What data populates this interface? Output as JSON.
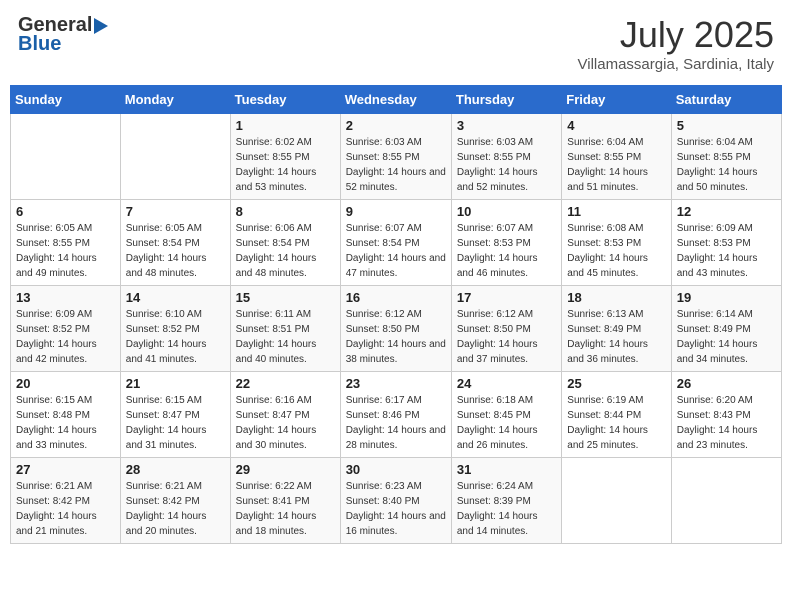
{
  "header": {
    "logo_general": "General",
    "logo_blue": "Blue",
    "month_year": "July 2025",
    "location": "Villamassargia, Sardinia, Italy"
  },
  "weekdays": [
    "Sunday",
    "Monday",
    "Tuesday",
    "Wednesday",
    "Thursday",
    "Friday",
    "Saturday"
  ],
  "weeks": [
    [
      {
        "day": "",
        "sunrise": "",
        "sunset": "",
        "daylight": ""
      },
      {
        "day": "",
        "sunrise": "",
        "sunset": "",
        "daylight": ""
      },
      {
        "day": "1",
        "sunrise": "Sunrise: 6:02 AM",
        "sunset": "Sunset: 8:55 PM",
        "daylight": "Daylight: 14 hours and 53 minutes."
      },
      {
        "day": "2",
        "sunrise": "Sunrise: 6:03 AM",
        "sunset": "Sunset: 8:55 PM",
        "daylight": "Daylight: 14 hours and 52 minutes."
      },
      {
        "day": "3",
        "sunrise": "Sunrise: 6:03 AM",
        "sunset": "Sunset: 8:55 PM",
        "daylight": "Daylight: 14 hours and 52 minutes."
      },
      {
        "day": "4",
        "sunrise": "Sunrise: 6:04 AM",
        "sunset": "Sunset: 8:55 PM",
        "daylight": "Daylight: 14 hours and 51 minutes."
      },
      {
        "day": "5",
        "sunrise": "Sunrise: 6:04 AM",
        "sunset": "Sunset: 8:55 PM",
        "daylight": "Daylight: 14 hours and 50 minutes."
      }
    ],
    [
      {
        "day": "6",
        "sunrise": "Sunrise: 6:05 AM",
        "sunset": "Sunset: 8:55 PM",
        "daylight": "Daylight: 14 hours and 49 minutes."
      },
      {
        "day": "7",
        "sunrise": "Sunrise: 6:05 AM",
        "sunset": "Sunset: 8:54 PM",
        "daylight": "Daylight: 14 hours and 48 minutes."
      },
      {
        "day": "8",
        "sunrise": "Sunrise: 6:06 AM",
        "sunset": "Sunset: 8:54 PM",
        "daylight": "Daylight: 14 hours and 48 minutes."
      },
      {
        "day": "9",
        "sunrise": "Sunrise: 6:07 AM",
        "sunset": "Sunset: 8:54 PM",
        "daylight": "Daylight: 14 hours and 47 minutes."
      },
      {
        "day": "10",
        "sunrise": "Sunrise: 6:07 AM",
        "sunset": "Sunset: 8:53 PM",
        "daylight": "Daylight: 14 hours and 46 minutes."
      },
      {
        "day": "11",
        "sunrise": "Sunrise: 6:08 AM",
        "sunset": "Sunset: 8:53 PM",
        "daylight": "Daylight: 14 hours and 45 minutes."
      },
      {
        "day": "12",
        "sunrise": "Sunrise: 6:09 AM",
        "sunset": "Sunset: 8:53 PM",
        "daylight": "Daylight: 14 hours and 43 minutes."
      }
    ],
    [
      {
        "day": "13",
        "sunrise": "Sunrise: 6:09 AM",
        "sunset": "Sunset: 8:52 PM",
        "daylight": "Daylight: 14 hours and 42 minutes."
      },
      {
        "day": "14",
        "sunrise": "Sunrise: 6:10 AM",
        "sunset": "Sunset: 8:52 PM",
        "daylight": "Daylight: 14 hours and 41 minutes."
      },
      {
        "day": "15",
        "sunrise": "Sunrise: 6:11 AM",
        "sunset": "Sunset: 8:51 PM",
        "daylight": "Daylight: 14 hours and 40 minutes."
      },
      {
        "day": "16",
        "sunrise": "Sunrise: 6:12 AM",
        "sunset": "Sunset: 8:50 PM",
        "daylight": "Daylight: 14 hours and 38 minutes."
      },
      {
        "day": "17",
        "sunrise": "Sunrise: 6:12 AM",
        "sunset": "Sunset: 8:50 PM",
        "daylight": "Daylight: 14 hours and 37 minutes."
      },
      {
        "day": "18",
        "sunrise": "Sunrise: 6:13 AM",
        "sunset": "Sunset: 8:49 PM",
        "daylight": "Daylight: 14 hours and 36 minutes."
      },
      {
        "day": "19",
        "sunrise": "Sunrise: 6:14 AM",
        "sunset": "Sunset: 8:49 PM",
        "daylight": "Daylight: 14 hours and 34 minutes."
      }
    ],
    [
      {
        "day": "20",
        "sunrise": "Sunrise: 6:15 AM",
        "sunset": "Sunset: 8:48 PM",
        "daylight": "Daylight: 14 hours and 33 minutes."
      },
      {
        "day": "21",
        "sunrise": "Sunrise: 6:15 AM",
        "sunset": "Sunset: 8:47 PM",
        "daylight": "Daylight: 14 hours and 31 minutes."
      },
      {
        "day": "22",
        "sunrise": "Sunrise: 6:16 AM",
        "sunset": "Sunset: 8:47 PM",
        "daylight": "Daylight: 14 hours and 30 minutes."
      },
      {
        "day": "23",
        "sunrise": "Sunrise: 6:17 AM",
        "sunset": "Sunset: 8:46 PM",
        "daylight": "Daylight: 14 hours and 28 minutes."
      },
      {
        "day": "24",
        "sunrise": "Sunrise: 6:18 AM",
        "sunset": "Sunset: 8:45 PM",
        "daylight": "Daylight: 14 hours and 26 minutes."
      },
      {
        "day": "25",
        "sunrise": "Sunrise: 6:19 AM",
        "sunset": "Sunset: 8:44 PM",
        "daylight": "Daylight: 14 hours and 25 minutes."
      },
      {
        "day": "26",
        "sunrise": "Sunrise: 6:20 AM",
        "sunset": "Sunset: 8:43 PM",
        "daylight": "Daylight: 14 hours and 23 minutes."
      }
    ],
    [
      {
        "day": "27",
        "sunrise": "Sunrise: 6:21 AM",
        "sunset": "Sunset: 8:42 PM",
        "daylight": "Daylight: 14 hours and 21 minutes."
      },
      {
        "day": "28",
        "sunrise": "Sunrise: 6:21 AM",
        "sunset": "Sunset: 8:42 PM",
        "daylight": "Daylight: 14 hours and 20 minutes."
      },
      {
        "day": "29",
        "sunrise": "Sunrise: 6:22 AM",
        "sunset": "Sunset: 8:41 PM",
        "daylight": "Daylight: 14 hours and 18 minutes."
      },
      {
        "day": "30",
        "sunrise": "Sunrise: 6:23 AM",
        "sunset": "Sunset: 8:40 PM",
        "daylight": "Daylight: 14 hours and 16 minutes."
      },
      {
        "day": "31",
        "sunrise": "Sunrise: 6:24 AM",
        "sunset": "Sunset: 8:39 PM",
        "daylight": "Daylight: 14 hours and 14 minutes."
      },
      {
        "day": "",
        "sunrise": "",
        "sunset": "",
        "daylight": ""
      },
      {
        "day": "",
        "sunrise": "",
        "sunset": "",
        "daylight": ""
      }
    ]
  ]
}
